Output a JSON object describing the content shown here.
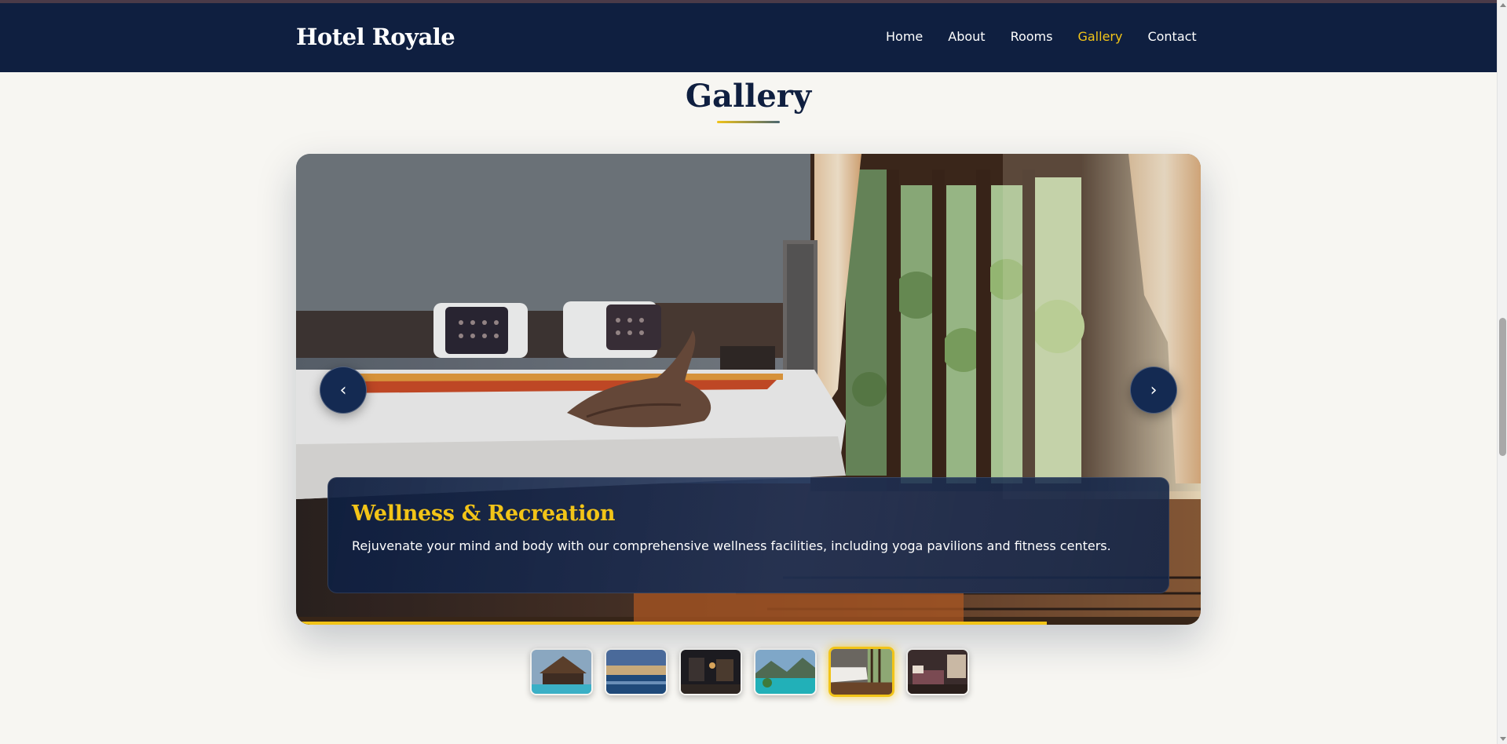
{
  "header": {
    "logo": "Hotel Royale",
    "nav": [
      "Home",
      "About",
      "Rooms",
      "Gallery",
      "Contact"
    ],
    "active_nav": "Gallery"
  },
  "gallery": {
    "title": "Gallery",
    "slide": {
      "title": "Wellness & Recreation",
      "description": "Rejuvenate your mind and body with our comprehensive wellness facilities, including yoga pavilions and fitness centers."
    },
    "prev_icon": "chevron-left-icon",
    "next_icon": "chevron-right-icon",
    "prev_glyph": "‹",
    "next_glyph": "›",
    "slide_progress": 0.83,
    "thumbnail_count": 6,
    "active_thumbnail": 5
  },
  "colors": {
    "navy": "#0f1f40",
    "gold": "#f2c418",
    "background": "#f7f6f2"
  }
}
